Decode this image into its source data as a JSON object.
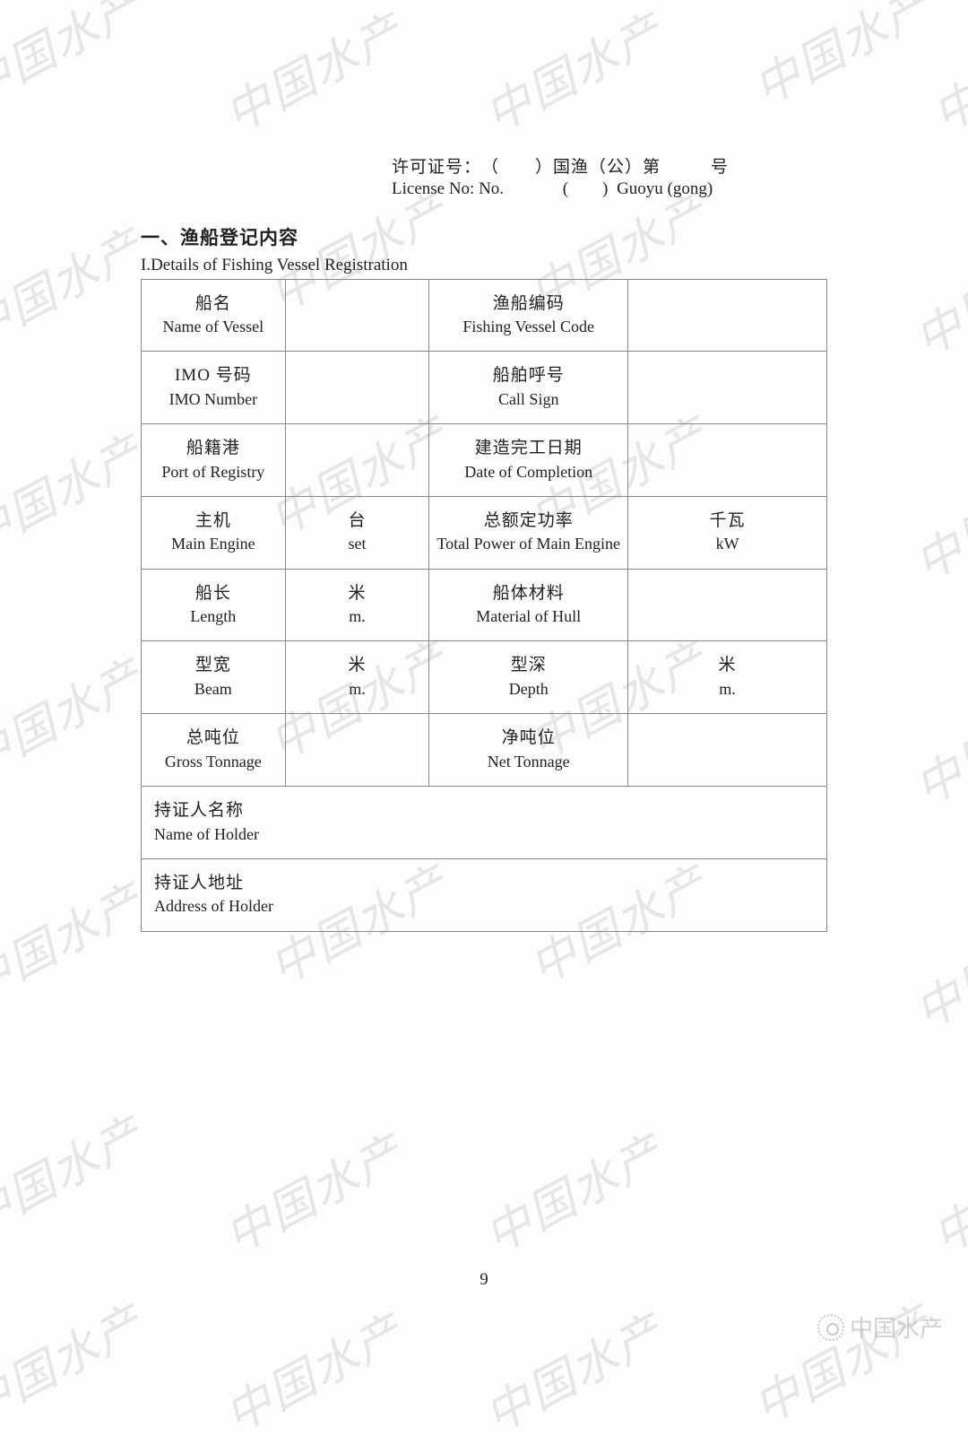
{
  "watermark": {
    "text": "中国水产"
  },
  "license": {
    "cn_label": "许可证号：",
    "cn_mid": "国渔（公）第",
    "cn_end": "号",
    "en_label": "License No: No.",
    "en_mid": "Guoyu (gong)"
  },
  "section": {
    "heading": "一、渔船登记内容",
    "sub": "I.Details of Fishing Vessel Registration"
  },
  "rows": [
    {
      "l_cn": "船名",
      "l_en": "Name of Vessel",
      "l_val": "",
      "r_cn": "渔船编码",
      "r_en": "Fishing Vessel Code",
      "r_val": ""
    },
    {
      "l_cn": "IMO 号码",
      "l_en": "IMO Number",
      "l_val": "",
      "r_cn": "船舶呼号",
      "r_en": "Call Sign",
      "r_val": ""
    },
    {
      "l_cn": "船籍港",
      "l_en": "Port of Registry",
      "l_val": "",
      "r_cn": "建造完工日期",
      "r_en": "Date of Completion",
      "r_val": ""
    },
    {
      "l_cn": "主机",
      "l_en": "Main Engine",
      "l_val_cn": "台",
      "l_val_en": "set",
      "r_cn": "总额定功率",
      "r_en": "Total Power of Main Engine",
      "r_val_cn": "千瓦",
      "r_val_en": "kW"
    },
    {
      "l_cn": "船长",
      "l_en": "Length",
      "l_val_cn": "米",
      "l_val_en": "m.",
      "r_cn": "船体材料",
      "r_en": "Material of Hull",
      "r_val": ""
    },
    {
      "l_cn": "型宽",
      "l_en": "Beam",
      "l_val_cn": "米",
      "l_val_en": "m.",
      "r_cn": "型深",
      "r_en": "Depth",
      "r_val_cn": "米",
      "r_val_en": "m."
    },
    {
      "l_cn": "总吨位",
      "l_en": "Gross Tonnage",
      "l_val": "",
      "r_cn": "净吨位",
      "r_en": "Net Tonnage",
      "r_val": ""
    }
  ],
  "fullrows": [
    {
      "cn": "持证人名称",
      "en": "Name of Holder",
      "val": ""
    },
    {
      "cn": "持证人地址",
      "en": "Address of Holder",
      "val": ""
    }
  ],
  "page_number": "9",
  "footer_brand": "中国水产"
}
